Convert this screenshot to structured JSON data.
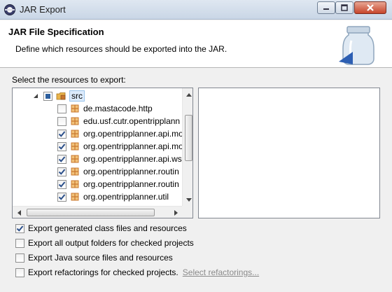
{
  "window": {
    "title": "JAR Export"
  },
  "banner": {
    "title": "JAR File Specification",
    "description": "Define which resources should be exported into the JAR."
  },
  "resources": {
    "label": "Select the resources to export:",
    "root": {
      "label": "src",
      "state": "partial",
      "expanded": true
    },
    "items": [
      {
        "label": "de.mastacode.http",
        "checked": false
      },
      {
        "label": "edu.usf.cutr.opentripplann",
        "checked": false
      },
      {
        "label": "org.opentripplanner.api.mo",
        "checked": true
      },
      {
        "label": "org.opentripplanner.api.mo",
        "checked": true
      },
      {
        "label": "org.opentripplanner.api.ws",
        "checked": true
      },
      {
        "label": "org.opentripplanner.routin",
        "checked": true
      },
      {
        "label": "org.opentripplanner.routin",
        "checked": true
      },
      {
        "label": "org.opentripplanner.util",
        "checked": true
      }
    ]
  },
  "options": [
    {
      "label": "Export generated class files and resources",
      "checked": true
    },
    {
      "label": "Export all output folders for checked projects",
      "checked": false
    },
    {
      "label": "Export Java source files and resources",
      "checked": false
    },
    {
      "label": "Export refactorings for checked projects.",
      "checked": false,
      "link": "Select refactorings..."
    }
  ],
  "colors": {
    "check_mark": "#2b4f8a",
    "package_icon": "#c9772e"
  }
}
